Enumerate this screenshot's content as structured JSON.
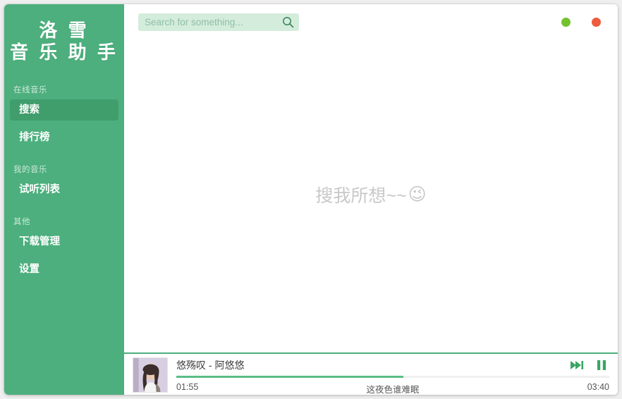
{
  "app": {
    "brand_line1": "洛 雪",
    "brand_line2": "音 乐 助 手"
  },
  "sidebar": {
    "groups": [
      {
        "title": "在线音乐",
        "items": [
          {
            "label": "搜索",
            "active": true
          },
          {
            "label": "排行榜",
            "active": false
          }
        ]
      },
      {
        "title": "我的音乐",
        "items": [
          {
            "label": "试听列表",
            "active": false
          }
        ]
      },
      {
        "title": "其他",
        "items": [
          {
            "label": "下载管理",
            "active": false
          },
          {
            "label": "设置",
            "active": false
          }
        ]
      }
    ]
  },
  "topbar": {
    "search_placeholder": "Search for something...",
    "search_value": "",
    "search_icon": "search-icon",
    "window_controls": [
      {
        "name": "minimize",
        "color": "#74c230"
      },
      {
        "name": "close",
        "color": "#ef5b3c"
      }
    ]
  },
  "content": {
    "empty_hint_text": "搜我所想~~",
    "empty_hint_emoji": "😉"
  },
  "player": {
    "song_title": "悠殇叹 - 阿悠悠",
    "time_current": "01:55",
    "time_total": "03:40",
    "lyric": "这夜色谁难眠",
    "progress_percent": "52.5",
    "controls": [
      {
        "name": "next-track-icon",
        "label": "下一首"
      },
      {
        "name": "pause-icon",
        "label": "暂停"
      }
    ]
  },
  "colors": {
    "sidebar_green": "#4caf7d",
    "active_green": "#409d6c",
    "accent_green": "#5cbd86",
    "search_bg": "#d4ecdc",
    "minimize": "#74c230",
    "close": "#ef5b3c"
  }
}
